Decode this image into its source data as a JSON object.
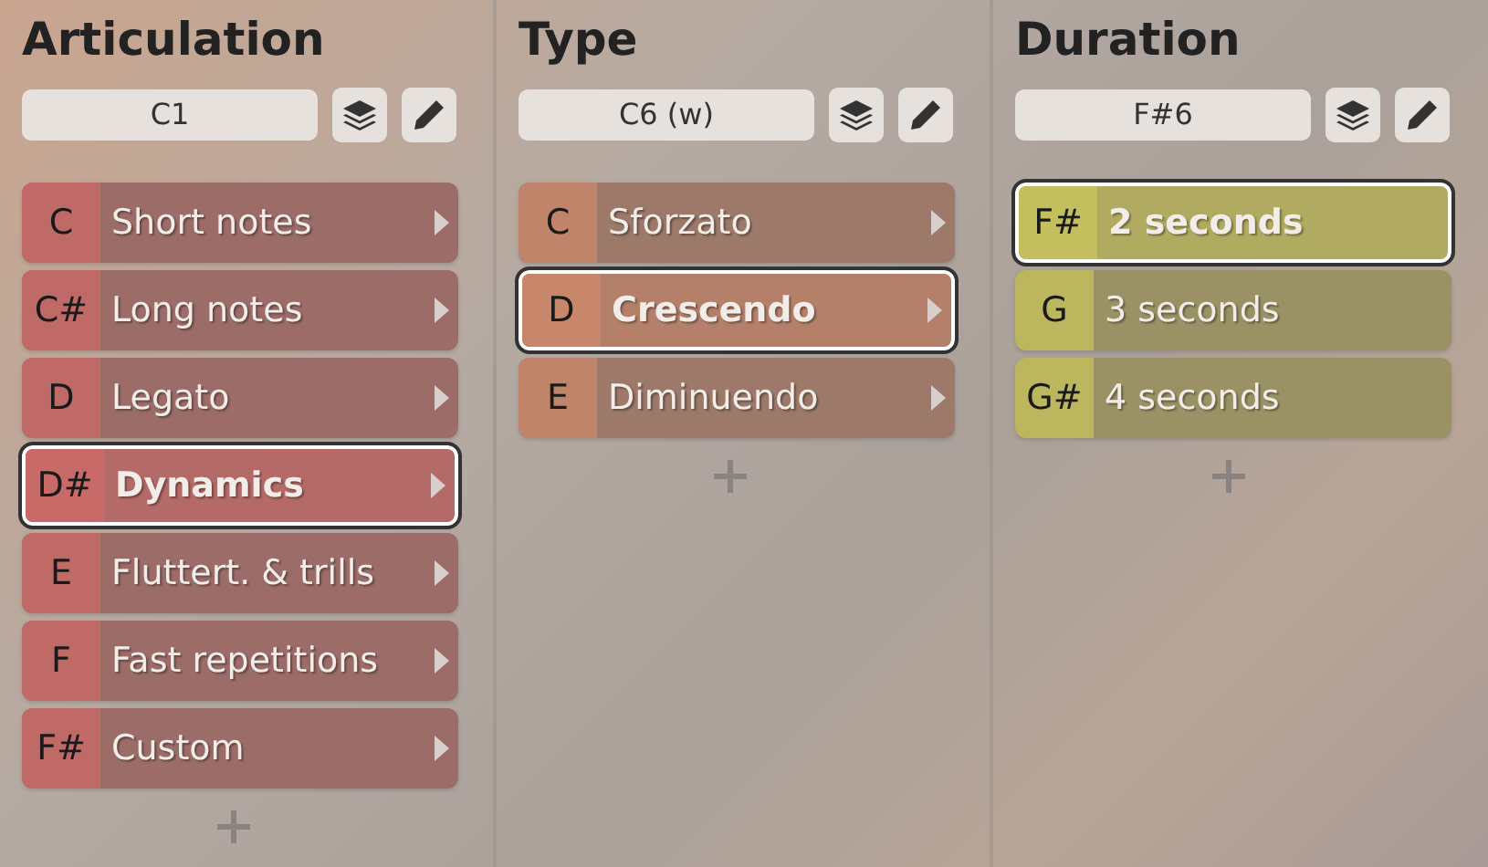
{
  "columns": [
    {
      "title": "Articulation",
      "field": "C1",
      "color": "#c86a68",
      "items": [
        {
          "key": "C",
          "label": "Short notes",
          "selected": false,
          "expandable": true
        },
        {
          "key": "C#",
          "label": "Long notes",
          "selected": false,
          "expandable": true
        },
        {
          "key": "D",
          "label": "Legato",
          "selected": false,
          "expandable": true
        },
        {
          "key": "D#",
          "label": "Dynamics",
          "selected": true,
          "expandable": true
        },
        {
          "key": "E",
          "label": "Fluttert. & trills",
          "selected": false,
          "expandable": true
        },
        {
          "key": "F",
          "label": "Fast repetitions",
          "selected": false,
          "expandable": true
        },
        {
          "key": "F#",
          "label": "Custom",
          "selected": false,
          "expandable": true
        }
      ]
    },
    {
      "title": "Type",
      "field": "C6 (w)",
      "color": "#c8866a",
      "items": [
        {
          "key": "C",
          "label": "Sforzato",
          "selected": false,
          "expandable": true
        },
        {
          "key": "D",
          "label": "Crescendo",
          "selected": true,
          "expandable": true
        },
        {
          "key": "E",
          "label": "Diminuendo",
          "selected": false,
          "expandable": true
        }
      ]
    },
    {
      "title": "Duration",
      "field": "F#6",
      "color": "#c4bf5e",
      "items": [
        {
          "key": "F#",
          "label": "2 seconds",
          "selected": true,
          "expandable": false
        },
        {
          "key": "G",
          "label": "3 seconds",
          "selected": false,
          "expandable": false
        },
        {
          "key": "G#",
          "label": "4 seconds",
          "selected": false,
          "expandable": false
        }
      ]
    }
  ]
}
